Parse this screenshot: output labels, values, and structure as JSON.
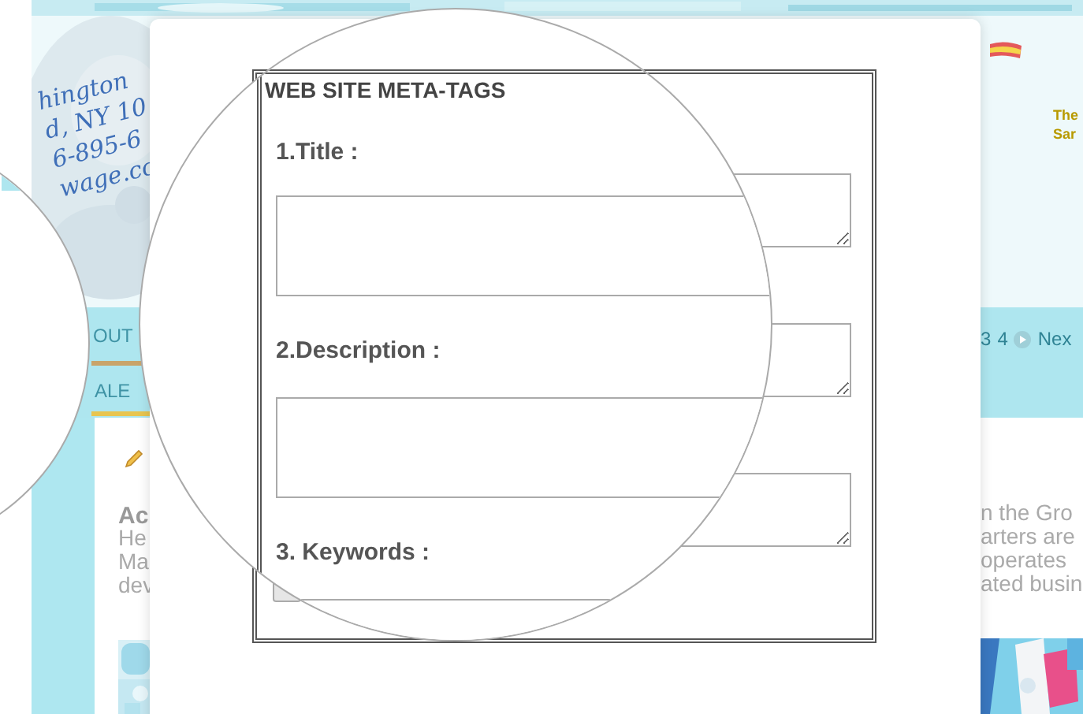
{
  "background_page": {
    "address_lines": [
      "hington",
      "d, NY 10",
      "6-895-6",
      "wage.co"
    ],
    "nav_items": [
      "OUT",
      "ALE"
    ],
    "pager": {
      "pages": [
        "3",
        "4"
      ],
      "next": "Nex"
    },
    "banner_lines": [
      "The",
      "Sar"
    ],
    "article": {
      "title": "Ac",
      "lines_left": [
        "He",
        "Ma",
        "dev"
      ],
      "lines_right": [
        "n the Gro",
        "arters are",
        "operates",
        "ated busin"
      ]
    }
  },
  "modal": {
    "fieldset_title": "WEB SITE META-TAGS",
    "fields": [
      {
        "label": "1.Title :"
      },
      {
        "label": "2.Description :"
      },
      {
        "label": "3. Keywords :"
      }
    ]
  }
}
